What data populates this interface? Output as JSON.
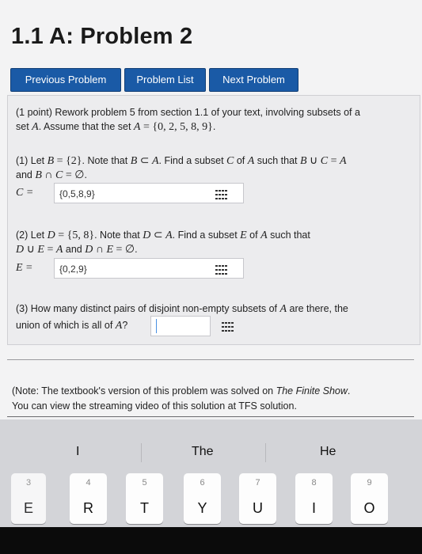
{
  "page": {
    "title": "1.1 A: Problem 2"
  },
  "nav": {
    "previous": "Previous Problem",
    "list": "Problem List",
    "next": "Next Problem"
  },
  "problem": {
    "intro": {
      "points": "(1 point) Rework problem 5 from section 1.1 of your text, involving subsets of a",
      "line2_a": "set ",
      "A": "A",
      "line2_b": ". Assume that the set ",
      "eq": " = ",
      "set": "{0, 2, 5, 8, 9}",
      "end": "."
    },
    "part1": {
      "l1_a": "(1) Let ",
      "B": "B",
      "eq": " = ",
      "Bset": "{2}",
      "l1_b": ". Note that ",
      "B2": "B",
      "subset": " ⊂ ",
      "A": "A",
      "l1_c": ". Find a subset ",
      "C": "C",
      "of": " of ",
      "A2": "A",
      "such": " such that ",
      "B3": "B",
      "union": " ∪ ",
      "C2": "C",
      "eq2": " = ",
      "A3": "A",
      "l2_a": "and ",
      "B4": "B",
      "inter": " ∩ ",
      "C3": "C",
      "empty": " = ∅",
      "end": ".",
      "label": "C = ",
      "answer": "{0,5,8,9}"
    },
    "part2": {
      "l1_a": "(2) Let ",
      "D": "D",
      "eq": " = ",
      "Dset": "{5, 8}",
      "l1_b": ". Note that ",
      "D2": "D",
      "subset": " ⊂ ",
      "A": "A",
      "l1_c": ". Find a subset ",
      "E": "E",
      "of": " of ",
      "A2": "A",
      "such": " such that",
      "l2_D": "D",
      "union": " ∪ ",
      "l2_E": "E",
      "eq2": " = ",
      "l2_A": "A",
      "and": " and ",
      "l2_D2": "D",
      "inter": " ∩ ",
      "l2_E2": "E",
      "empty": " = ∅",
      "end": ".",
      "label": "E = ",
      "answer": "{0,2,9}"
    },
    "part3": {
      "l1_a": "(3) How many distinct pairs of disjoint non-empty subsets of ",
      "A": "A",
      "l1_b": " are there, the",
      "l2_a": "union of which is all of ",
      "A2": "A",
      "l2_b": "?",
      "answer": ""
    }
  },
  "note": {
    "l1_a": "(Note: The textbook's version of this problem was solved on ",
    "l1_em": "The Finite Show",
    "l1_b": ".",
    "l2": "You can view the streaming video of this solution at TFS solution."
  },
  "keyboard": {
    "suggestions": [
      "I",
      "The",
      "He"
    ],
    "keys": [
      {
        "num": "3",
        "letter": "E"
      },
      {
        "num": "4",
        "letter": "R"
      },
      {
        "num": "5",
        "letter": "T"
      },
      {
        "num": "6",
        "letter": "Y"
      },
      {
        "num": "7",
        "letter": "U"
      },
      {
        "num": "8",
        "letter": "I"
      },
      {
        "num": "9",
        "letter": "O"
      }
    ]
  },
  "colors": {
    "nav_button": "#1a5aa6",
    "panel": "#ececee",
    "keyboard": "#d3d4d8"
  }
}
